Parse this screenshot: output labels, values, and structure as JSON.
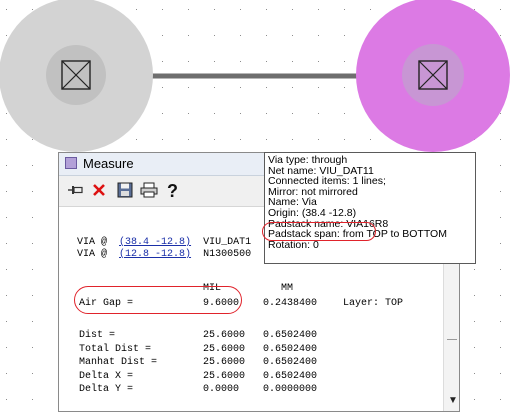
{
  "colors": {
    "left_pad": "#d3d3d3",
    "left_pad_inner": "#c1c1c1",
    "right_pad": "#dc7ae4",
    "right_pad_inner": "#c896d4",
    "trace": "#6e6e6e",
    "highlight": "#e0232b"
  },
  "icons": {
    "via_symbol": "via-cross-box-icon",
    "pin": "pin-icon",
    "close": "close-x-icon",
    "save": "floppy-save-icon",
    "print": "printer-icon",
    "help": "help-question-icon",
    "scroll_down": "scroll-down-arrow-icon"
  },
  "measure_window": {
    "title": "Measure"
  },
  "tooltip": {
    "lines": [
      "Via type: through",
      "Net name: VIU_DAT11",
      "Connected items: 1 lines;",
      "Mirror: not mirrored",
      "Name: Via",
      "Origin: (38.4 -12.8)",
      "Padstack name: VIA16R8",
      "Padstack span: from TOP to BOTTOM",
      "Rotation: 0"
    ]
  },
  "vias": [
    {
      "prefix": "VIA @",
      "coord": "(38.4 -12.8)",
      "net": "VIU_DAT1"
    },
    {
      "prefix": "VIA @",
      "coord": "(12.8 -12.8)",
      "net": "N1300500"
    }
  ],
  "units": {
    "mil": "MIL",
    "mm": "MM"
  },
  "air_gap": {
    "label": "Air Gap =",
    "mil": "9.6000",
    "mm": "0.2438400",
    "layer": "Layer: TOP"
  },
  "measurements": [
    {
      "label": "Dist =",
      "mil": "25.6000",
      "mm": "0.6502400"
    },
    {
      "label": "Total Dist =",
      "mil": "25.6000",
      "mm": "0.6502400"
    },
    {
      "label": "Manhat Dist =",
      "mil": "25.6000",
      "mm": "0.6502400"
    },
    {
      "label": "Delta X =",
      "mil": "25.6000",
      "mm": "0.6502400"
    },
    {
      "label": "Delta Y =",
      "mil": "0.0000",
      "mm": "0.0000000"
    }
  ]
}
